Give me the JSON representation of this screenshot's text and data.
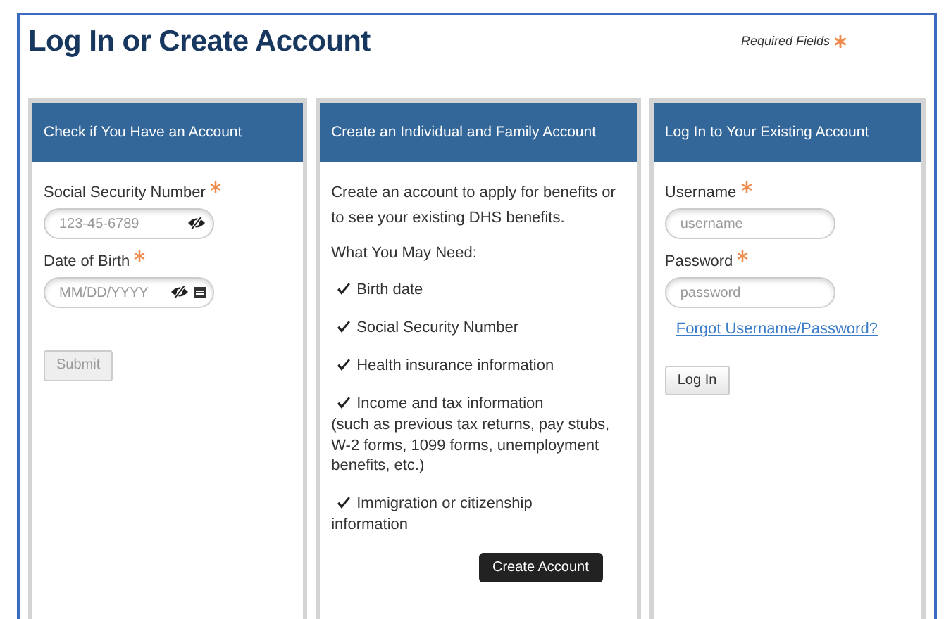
{
  "title": "Log In or Create Account",
  "required_note": "Required Fields",
  "panels": [
    {
      "kind": "check",
      "header": "Check if You Have an Account",
      "fields": [
        {
          "label": "Social Security Number",
          "required": true,
          "placeholder": "123-45-6789",
          "mask_toggle": true
        },
        {
          "label": "Date of Birth",
          "required": true,
          "placeholder": "MM/DD/YYYY",
          "mask_toggle": true,
          "calendar": true
        }
      ],
      "button": {
        "label": "Submit",
        "disabled": true
      }
    },
    {
      "kind": "create",
      "header": "Create an Individual and Family Account",
      "intro": "Create an account to apply for benefits or to see your existing DHS benefits.",
      "needs_heading": "What You May Need:",
      "needs": [
        {
          "text": "Birth date"
        },
        {
          "text": "Social Security Number"
        },
        {
          "text": "Health insurance information"
        },
        {
          "text": "Income and tax information",
          "detail": "(such as previous tax returns, pay stubs, W-2 forms, 1099 forms, unemployment benefits, etc.)"
        },
        {
          "text": "Immigration or citizenship",
          "detail": "information"
        }
      ],
      "button": {
        "label": "Create Account"
      }
    },
    {
      "kind": "login",
      "header": "Log In to Your Existing Account",
      "fields": [
        {
          "label": "Username",
          "required": true,
          "placeholder": "username"
        },
        {
          "label": "Password",
          "required": true,
          "placeholder": "password"
        }
      ],
      "link": "Forgot Username/Password?",
      "button": {
        "label": "Log In"
      }
    }
  ]
}
